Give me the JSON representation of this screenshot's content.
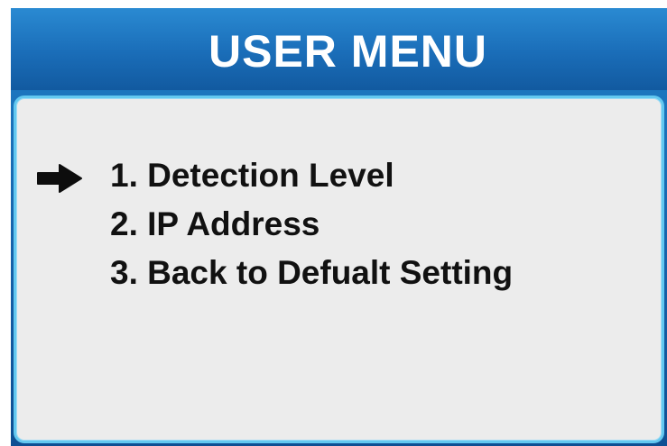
{
  "menu": {
    "title": "USER MENU",
    "items": [
      {
        "label": "1. Detection Level",
        "selected": true
      },
      {
        "label": "2. IP Address",
        "selected": false
      },
      {
        "label": "3. Back to Defualt Setting",
        "selected": false
      }
    ],
    "selector_icon": "arrow-right-icon"
  },
  "colors": {
    "title_bar": "#1a6db8",
    "title_text": "#ffffff",
    "panel_background": "#ececec",
    "panel_border": "#63c8f0",
    "item_text": "#111111"
  }
}
